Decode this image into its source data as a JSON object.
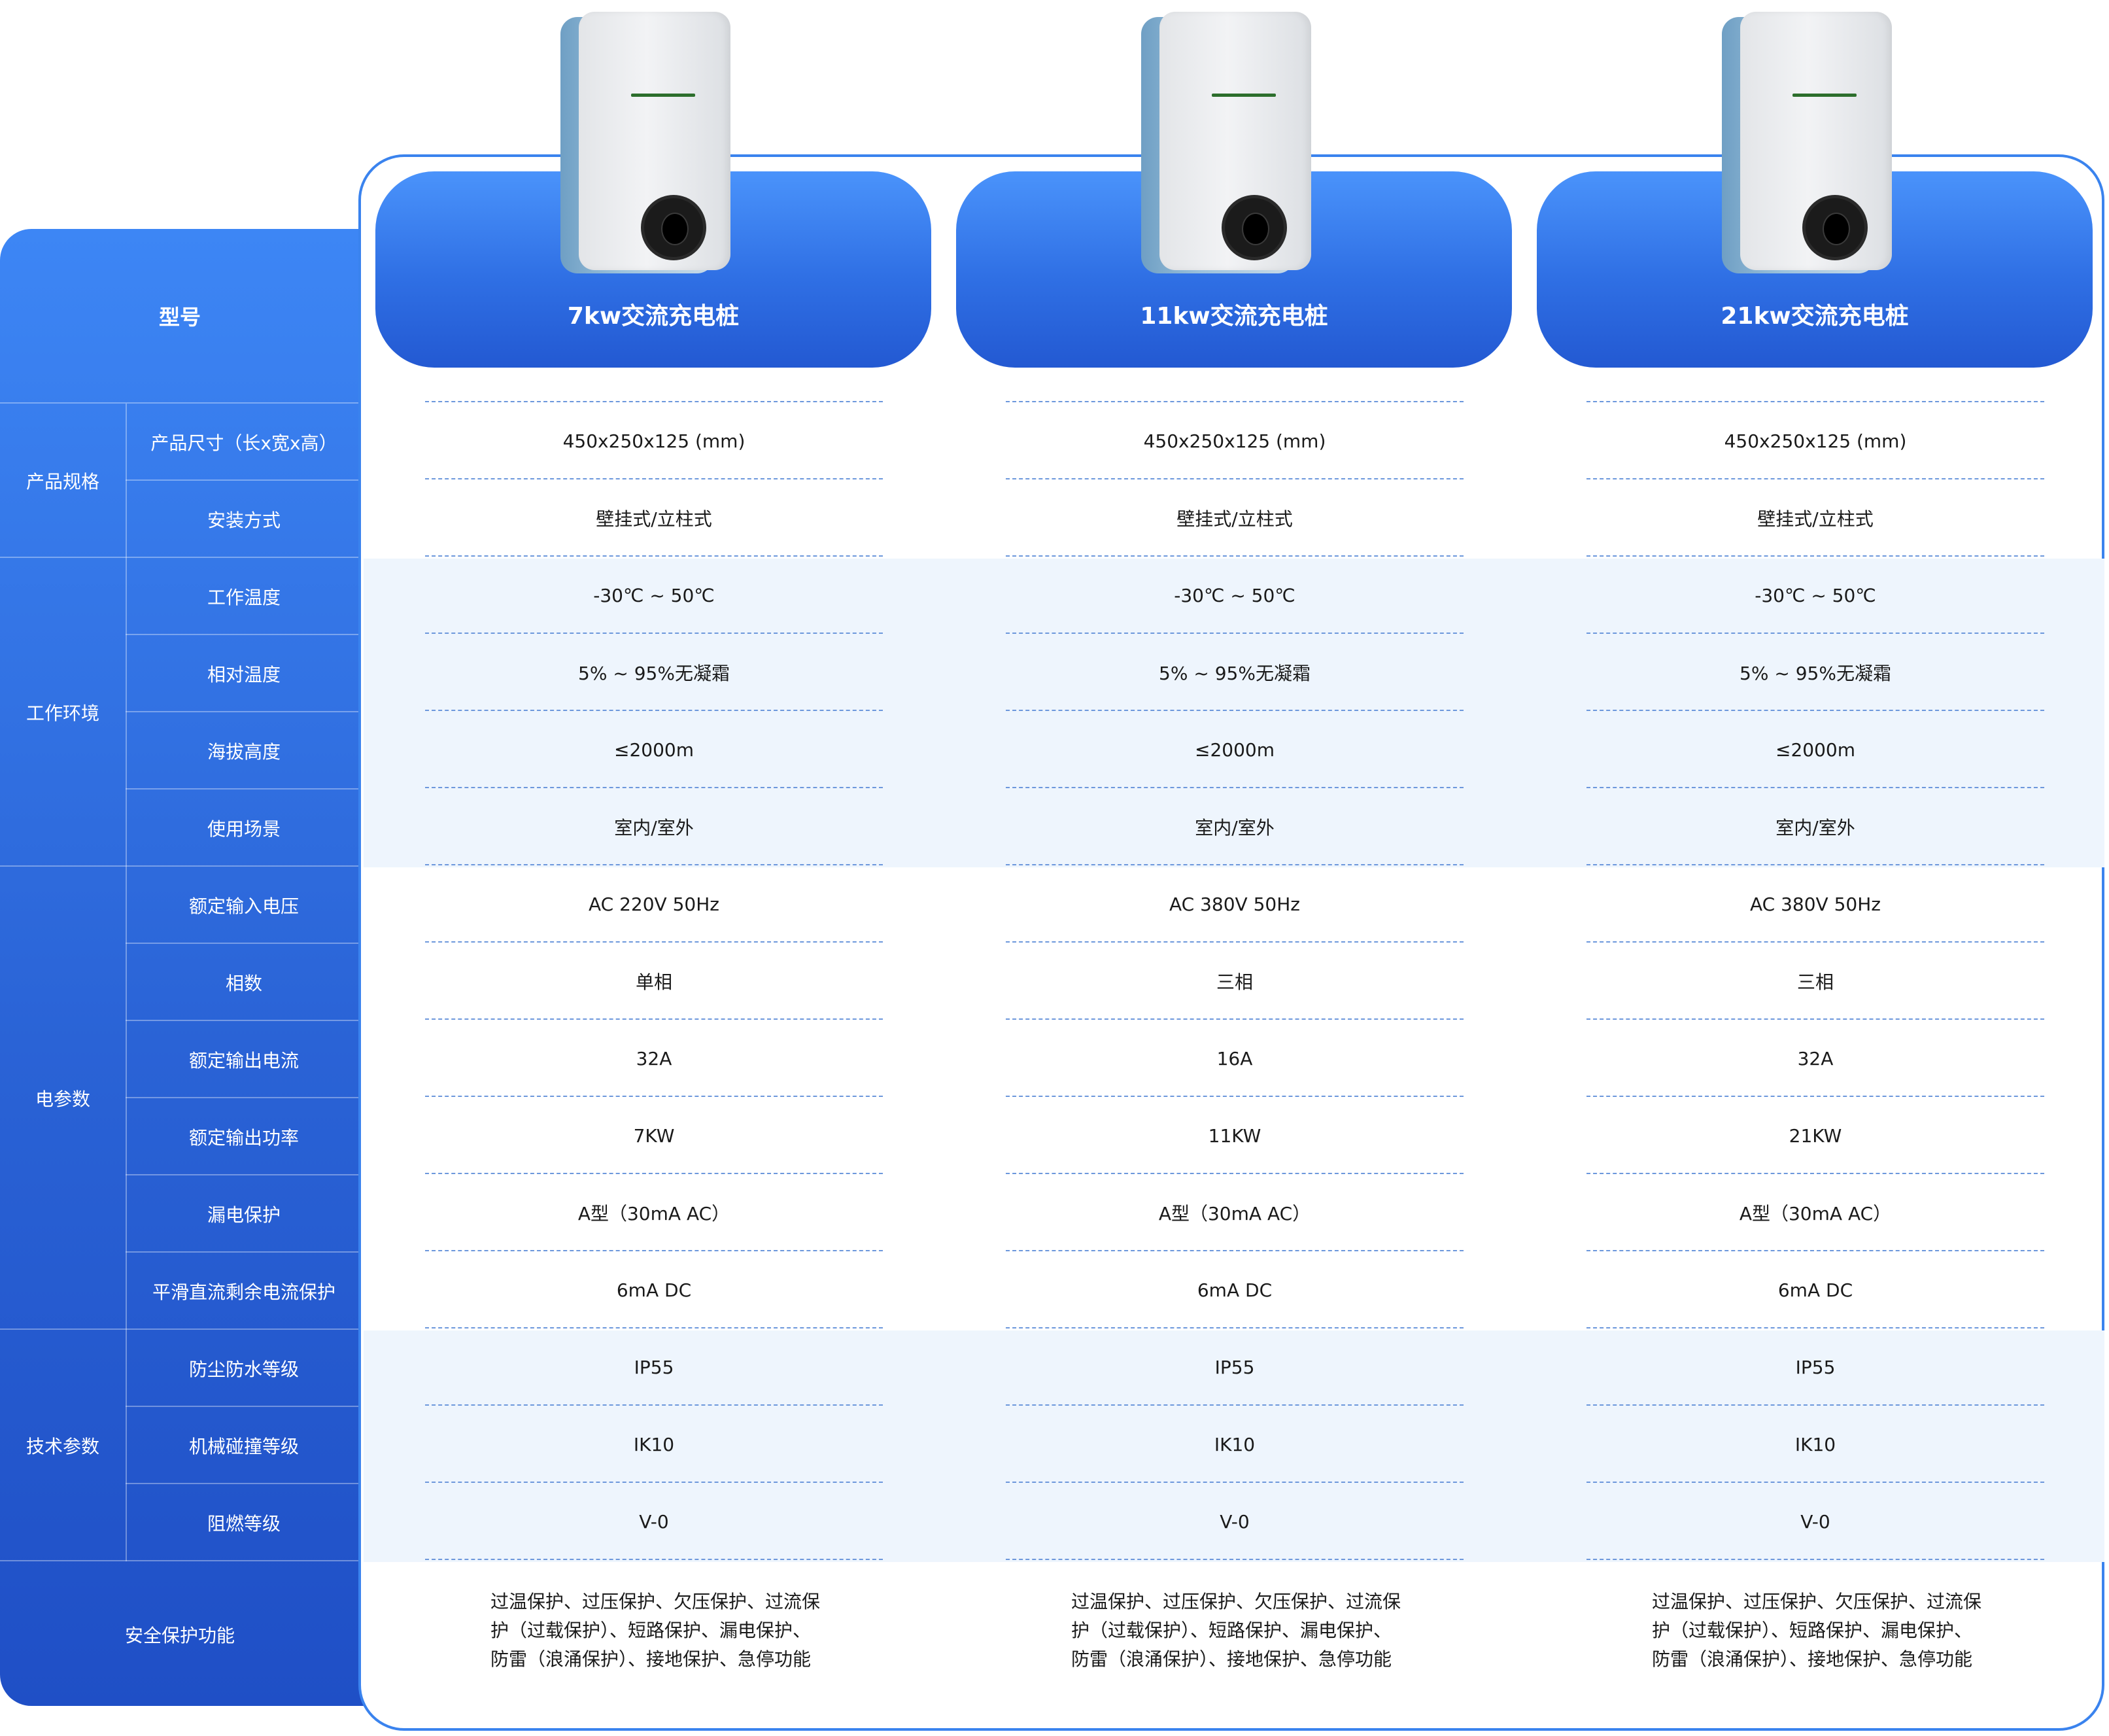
{
  "header_label": "型号",
  "models": [
    {
      "name": "7kw交流充电桩"
    },
    {
      "name": "11kw交流充电桩"
    },
    {
      "name": "21kw交流充电桩"
    }
  ],
  "groups": [
    {
      "label": "产品规格",
      "rows": [
        "产品尺寸（长x宽x高）",
        "安装方式"
      ]
    },
    {
      "label": "工作环境",
      "rows": [
        "工作温度",
        "相对温度",
        "海拔高度",
        "使用场景"
      ]
    },
    {
      "label": "电参数",
      "rows": [
        "额定输入电压",
        "相数",
        "额定输出电流",
        "额定输出功率",
        "漏电保护",
        "平滑直流剩余电流保护"
      ]
    },
    {
      "label": "技术参数",
      "rows": [
        "防尘防水等级",
        "机械碰撞等级",
        "阻燃等级"
      ]
    }
  ],
  "safety_label": "安全保护功能",
  "values": [
    [
      "450x250x125 (mm)",
      "450x250x125 (mm)",
      "450x250x125 (mm)"
    ],
    [
      "壁挂式/立柱式",
      "壁挂式/立柱式",
      "壁挂式/立柱式"
    ],
    [
      "-30℃ ~ 50℃",
      "-30℃ ~ 50℃",
      "-30℃ ~ 50℃"
    ],
    [
      "5% ~ 95%无凝霜",
      "5% ~ 95%无凝霜",
      "5% ~ 95%无凝霜"
    ],
    [
      "≤2000m",
      "≤2000m",
      "≤2000m"
    ],
    [
      "室内/室外",
      "室内/室外",
      "室内/室外"
    ],
    [
      "AC 220V 50Hz",
      "AC 380V 50Hz",
      "AC 380V 50Hz"
    ],
    [
      "单相",
      "三相",
      "三相"
    ],
    [
      "32A",
      "16A",
      "32A"
    ],
    [
      "7KW",
      "11KW",
      "21KW"
    ],
    [
      "A型（30mA AC）",
      "A型（30mA AC）",
      "A型（30mA AC）"
    ],
    [
      "6mA DC",
      "6mA DC",
      "6mA DC"
    ],
    [
      "IP55",
      "IP55",
      "IP55"
    ],
    [
      "IK10",
      "IK10",
      "IK10"
    ],
    [
      "V-0",
      "V-0",
      "V-0"
    ]
  ],
  "safety_lines": [
    [
      "过温保护、过压保护、欠压保护、过流保",
      "护（过载保护）、短路保护、漏电保护、",
      "防雷（浪涌保护）、接地保护、急停功能"
    ],
    [
      "过温保护、过压保护、欠压保护、过流保",
      "护（过载保护）、短路保护、漏电保护、",
      "防雷（浪涌保护）、接地保护、急停功能"
    ],
    [
      "过温保护、过压保护、欠压保护、过流保",
      "护（过载保护）、短路保护、漏电保护、",
      "防雷（浪涌保护）、接地保护、急停功能"
    ]
  ]
}
